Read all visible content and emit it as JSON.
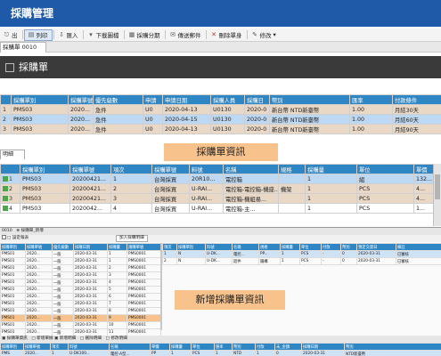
{
  "app": {
    "title": "採購管理"
  },
  "toolbar": {
    "items": [
      {
        "label": "出",
        "icon": "exit-icon"
      },
      {
        "label": "列印",
        "icon": "printer-icon"
      },
      {
        "label": "匯入",
        "icon": "import-icon"
      },
      {
        "label": "下載圖檔",
        "icon": "download-icon"
      },
      {
        "label": "採購分期",
        "icon": "calendar-icon"
      },
      {
        "label": "傳送郵件",
        "icon": "mail-icon"
      },
      {
        "label": "刪除單身",
        "icon": "delete-icon"
      },
      {
        "label": "修改",
        "icon": "edit-icon"
      }
    ],
    "selected_index": 1
  },
  "doc_tab": {
    "label": "採購單 0010"
  },
  "section": {
    "title": "採購單"
  },
  "header_grid": {
    "columns": [
      "",
      "採購單別",
      "採購單號",
      "優先級數",
      "申請",
      "申請日期",
      "採購人員",
      "採購日",
      "幣別",
      "匯率",
      "付款條件"
    ],
    "rows": [
      [
        "1",
        "PMS03",
        "2020...",
        "急件",
        "U0",
        "2020-04-13",
        "U0130",
        "2020-0",
        "新台幣 NTD新臺幣",
        "1.00",
        "月結30天"
      ],
      [
        "2",
        "PMS03",
        "2020...",
        "急件",
        "U0",
        "2020-04-15",
        "U0130",
        "2020-0",
        "新台幣 NTD新臺幣",
        "1.00",
        "月結60天"
      ],
      [
        "3",
        "PMS03",
        "2020...",
        "急件",
        "U0",
        "2020-04-13",
        "U0130",
        "2020-0",
        "新台幣 NTD新臺幣",
        "1.00",
        "月結90天"
      ]
    ]
  },
  "detail_tab": {
    "label": "明細"
  },
  "callouts": {
    "top": "採購單資訊",
    "bottom": "新增採購單資訊"
  },
  "detail_grid": {
    "columns": [
      "",
      "採購單別",
      "採購單號",
      "項次",
      "採購單號",
      "料號",
      "名稱",
      "規格",
      "採購量",
      "單位",
      "單價"
    ],
    "rows": [
      [
        "1",
        "PMS03",
        "20200421...",
        "1",
        "台灣採買",
        "20R10...",
        "電控箱",
        "",
        "1",
        "組",
        "132..."
      ],
      [
        "2",
        "PMS03",
        "20200421...",
        "2",
        "台灣採買",
        "U-RAI...",
        "電控箱-電控箱-機座...",
        "機架",
        "1",
        "PCS",
        "4..."
      ],
      [
        "3",
        "PMS03",
        "20200421...",
        "3",
        "台灣採買",
        "U-RAI...",
        "電控箱-機組易...",
        "",
        "1",
        "PCS",
        "4..."
      ],
      [
        "4",
        "PMS03",
        "2020042...",
        "4",
        "台灣採買",
        "U-RAI...",
        "電控箱-主...",
        "",
        "1",
        "PCS",
        "1..."
      ]
    ]
  },
  "inset": {
    "tabs": "0010　⊗ 採購單_新增",
    "bar_label": "□ 設定報表",
    "bar_button": "加入採購明細",
    "left_columns": [
      "採購單別",
      "採購單號",
      "優先級數",
      "採購日期",
      "採購量",
      "請購單號"
    ],
    "left_rows": [
      [
        "PMS01",
        "2020...",
        "一般",
        "2020-03-31",
        "1",
        "PMS0001"
      ],
      [
        "PMS01",
        "2020...",
        "一般",
        "2020-03-31",
        "1",
        "PMS0001"
      ],
      [
        "PMS01",
        "2020...",
        "一般",
        "2020-03-31",
        "2",
        "PMS0001"
      ],
      [
        "PMS01",
        "2020...",
        "一般",
        "2020-03-31",
        "3",
        "PMS0001"
      ],
      [
        "PMS01",
        "2020...",
        "一般",
        "2020-03-31",
        "4",
        "PMS0001"
      ],
      [
        "PMS01",
        "2020...",
        "一般",
        "2020-03-31",
        "5",
        "PMS0001"
      ],
      [
        "PMS01",
        "2020...",
        "一般",
        "2020-03-31",
        "6",
        "PMS0001"
      ],
      [
        "PMS01",
        "2020...",
        "一般",
        "2020-03-31",
        "7",
        "PMS0001"
      ],
      [
        "PMS01",
        "2020...",
        "一般",
        "2020-03-31",
        "8",
        "PMS0001"
      ],
      [
        "PMS01",
        "2020...",
        "一般",
        "2020-03-31",
        "9",
        "PMS0001"
      ],
      [
        "PMS01",
        "2020...",
        "一般",
        "2020-03-31",
        "10",
        "PMS0001"
      ],
      [
        "PMS01",
        "2020...",
        "一般",
        "2020-03-31",
        "11",
        "PMS0001"
      ]
    ],
    "right_columns": [
      "項次",
      "採購單別",
      "料號",
      "名稱",
      "規格",
      "採購量",
      "單位",
      "付款",
      "幣別",
      "預定交貨日",
      "備註"
    ],
    "right_rows": [
      [
        "1",
        "N",
        "U-DK...",
        "電控...",
        "PP...",
        "1",
        "PCS",
        "-",
        "0",
        "2020-03-31",
        "已審核"
      ],
      [
        "2",
        "N",
        "U-DK...",
        "鋁件",
        "鐵構",
        "1",
        "PCS",
        "-",
        "0",
        "2020-03-31",
        "已審核"
      ]
    ],
    "bottom_bar": "▣ 採購單資訊　□ 新增單據 ▣ 新增明細　□ 刪除明細　□ 修改明細",
    "bottom_columns": [
      "採購單別",
      "採購單號",
      "項次",
      "料號",
      "名稱",
      "單價",
      "採購量",
      "單位",
      "匯率",
      "幣別",
      "付款",
      "未_金額",
      "採購日期",
      "幣別"
    ],
    "bottom_rows": [
      [
        "PMS",
        "2020...",
        "1",
        "U-DK100...",
        "電控-A型...",
        "PP",
        "1",
        "PCS",
        "1",
        "NTD",
        "1",
        "0",
        "2020-03-31",
        "NTD新臺幣"
      ],
      [
        "PMS",
        "2020...",
        "2",
        "U-DK100...",
        "鋁件-A...",
        "PP",
        "1",
        "PCS",
        "1",
        "NTD",
        "1",
        "0",
        "2020-03-31",
        "NTD新臺幣"
      ]
    ]
  },
  "colors": {
    "title_bg": "#1f5aa8",
    "header_bg": "#2e86c4",
    "selected_row": "#bdd8f3",
    "alt_row": "#ead8c6",
    "callout": "#f7c28c"
  }
}
